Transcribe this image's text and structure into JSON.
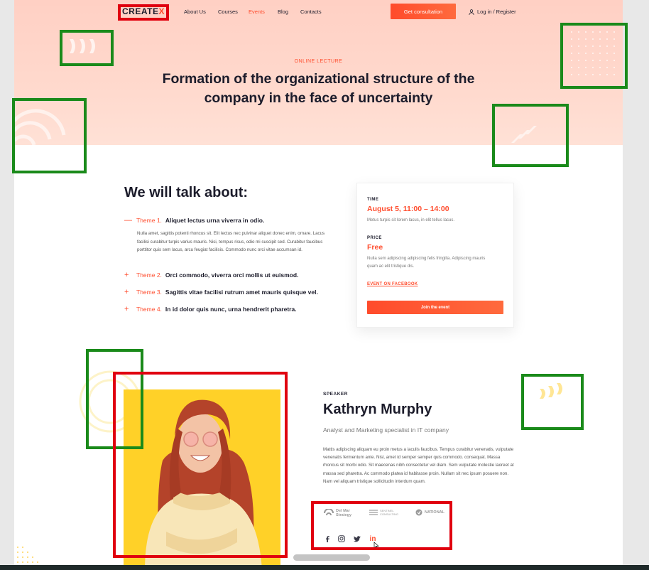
{
  "nav": {
    "logo_main": "CREATE",
    "logo_x": "X",
    "links": [
      "About Us",
      "Courses",
      "Events",
      "Blog",
      "Contacts"
    ],
    "cta": "Get consultation",
    "login": "Log in / Register"
  },
  "hero": {
    "tag": "ONLINE LECTURE",
    "title": "Formation of the organizational structure of the company in the face of uncertainty"
  },
  "talk": {
    "title": "We will talk about:",
    "themes": [
      {
        "sign": "—",
        "num": "Theme 1.",
        "text": "Aliquet lectus urna viverra in odio."
      },
      {
        "sign": "+",
        "num": "Theme 2.",
        "text": "Orci commodo, viverra orci mollis ut euismod."
      },
      {
        "sign": "+",
        "num": "Theme 3.",
        "text": "Sagittis vitae facilisi rutrum amet mauris quisque vel."
      },
      {
        "sign": "+",
        "num": "Theme 4.",
        "text": "In id dolor quis nunc, urna hendrerit pharetra."
      }
    ],
    "theme1_body": "Nulla amet, sagittis potenti rhoncus sit. Elit lectus nec pulvinar aliquet donec enim, ornare. Lacus facilisi curabitur turpis varius mauris. Nisi, tempus risus, odio mi suscipit sed. Curabitur faucibus porttitor quis sem lacus, arcu feugiat facilisis. Commodo nunc orci vitae accumsan id."
  },
  "card": {
    "time_label": "TIME",
    "time_value": "August 5, 11:00 – 14:00",
    "time_desc": "Metus turpis sit lorem lacus, in elit tellus lacus.",
    "price_label": "PRICE",
    "price_value": "Free",
    "price_desc": "Nulla sem adipiscing adipiscing felis fringilla. Adipiscing mauris quam ac elit tristique dis.",
    "facebook": "EVENT ON FACEBOOK",
    "join": "Join the event"
  },
  "speaker": {
    "tag": "SPEAKER",
    "name": "Kathryn Murphy",
    "role": "Analyst and Marketing specialist in IT company",
    "bio": "Mattis adipiscing aliquam eu proin metus a iaculis faucibus. Tempus curabitur venenatis, vulputate venenatis fermentum ante. Nisl, amet id semper semper quis commodo. consequat. Massa rhoncus sit morbi odio. Sit maecenas nibh consectetur vel diam. Sem vulputate molestie laoreet at massa sed pharetra. Ac commodo platea id habitasse proin. Nullam sit nec ipsum posuere non. Nam vel aliquam tristique sollicitudin interdum quam.",
    "partners": [
      "Del Mar Strategy",
      "SENTINEL CONSULTING",
      "NATIONAL"
    ],
    "socials": [
      "facebook-icon",
      "instagram-icon",
      "twitter-icon",
      "linkedin-icon"
    ]
  },
  "colors": {
    "accent": "#ff4d2e",
    "hero_bg": "#ffd5c8",
    "photo_bg": "#ffd128",
    "annotation_green": "#1a8a1a",
    "annotation_red": "#e0000f"
  }
}
